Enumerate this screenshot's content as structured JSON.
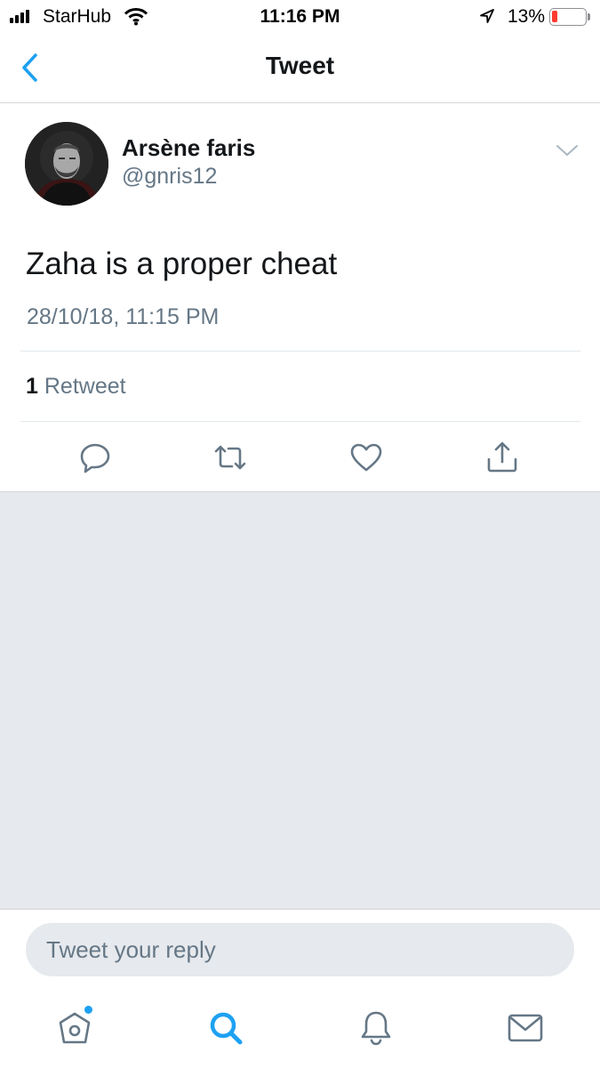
{
  "status_bar": {
    "carrier": "StarHub",
    "time": "11:16 PM",
    "battery_percent": "13%",
    "battery_level": 0.13,
    "icons": [
      "signal-icon",
      "wifi-icon",
      "location-icon",
      "battery-icon"
    ]
  },
  "nav": {
    "title": "Tweet",
    "back_icon": "chevron-left-icon"
  },
  "tweet": {
    "author_name": "Arsène faris",
    "handle": "@gnris12",
    "text": "Zaha is a proper cheat",
    "timestamp": "28/10/18, 11:15 PM",
    "retweet_count": "1",
    "retweet_label": "Retweet",
    "actions": [
      "reply-icon",
      "retweet-icon",
      "like-icon",
      "share-icon"
    ]
  },
  "reply": {
    "placeholder": "Tweet your reply"
  },
  "tab_bar": {
    "tabs": [
      "home-icon",
      "search-icon",
      "notifications-icon",
      "messages-icon"
    ],
    "active": "search-icon"
  },
  "colors": {
    "accent": "#1da1f2",
    "secondary_text": "#657786",
    "background_gray": "#e6e9ed",
    "battery_low": "#ff3b30"
  }
}
